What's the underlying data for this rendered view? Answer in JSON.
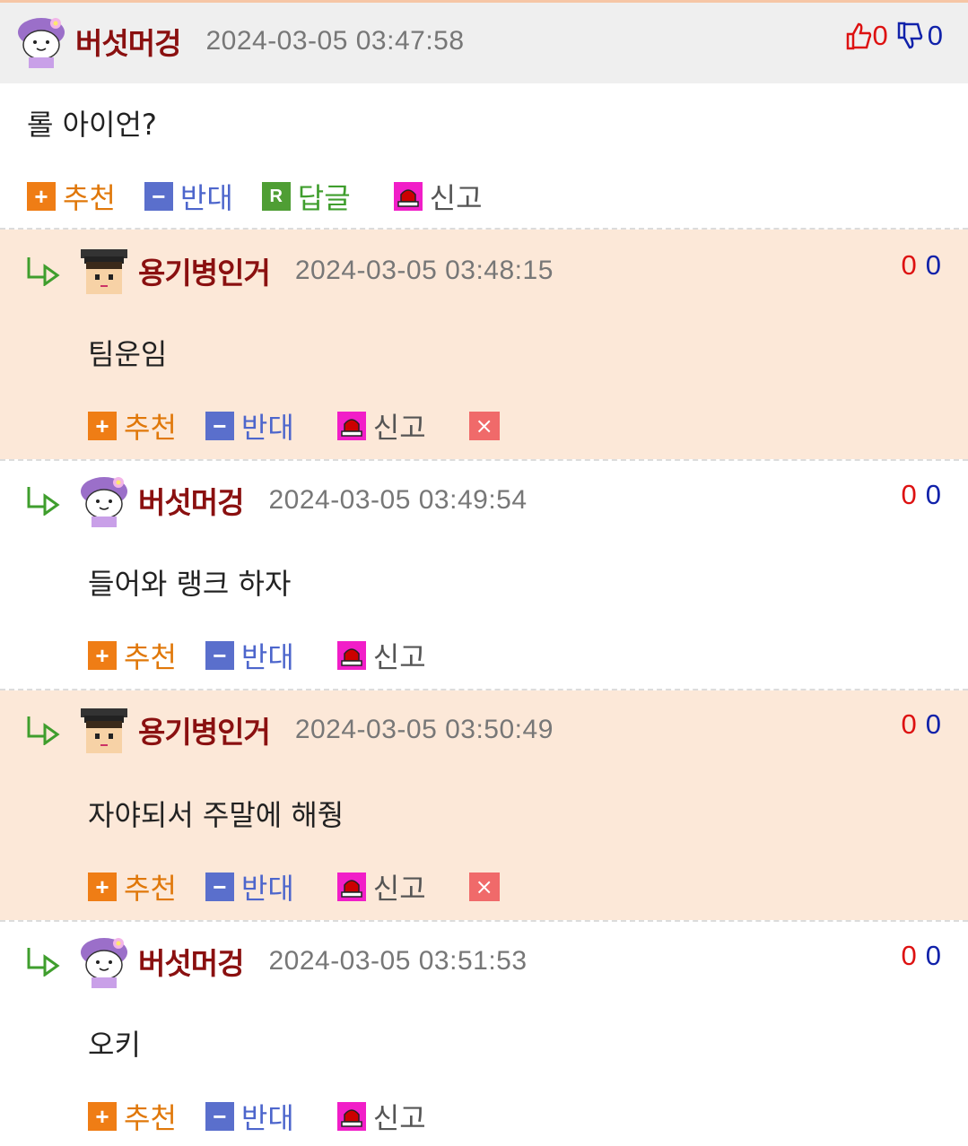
{
  "comments": [
    {
      "name": "버섯머겅",
      "date": "2024-03-05 03:47:58",
      "text": "롤 아이언?",
      "up": "0",
      "down": "0",
      "reply": "답글"
    },
    {
      "name": "용기병인거",
      "date": "2024-03-05 03:48:15",
      "text": "팀운임",
      "up": "0",
      "down": "0"
    },
    {
      "name": "버섯머겅",
      "date": "2024-03-05 03:49:54",
      "text": "들어와 랭크 하자",
      "up": "0",
      "down": "0"
    },
    {
      "name": "용기병인거",
      "date": "2024-03-05 03:50:49",
      "text": "자야되서 주말에 해줭",
      "up": "0",
      "down": "0"
    },
    {
      "name": "버섯머겅",
      "date": "2024-03-05 03:51:53",
      "text": "오키",
      "up": "0",
      "down": "0"
    }
  ],
  "actions": {
    "recommend": "추천",
    "oppose": "반대",
    "report": "신고",
    "plus": "+",
    "minus": "−",
    "reply_icon": "R",
    "delete_icon": "×"
  },
  "icons": {
    "thumbs_up": "thumbs-up-icon",
    "thumbs_down": "thumbs-down-icon",
    "reply_arrow": "reply-arrow-icon",
    "avatar_mushroom": "mushroom-avatar",
    "avatar_student": "graduate-avatar",
    "siren": "siren-icon"
  },
  "colors": {
    "header_bg": "#efefef",
    "reply_bg": "#fce8d8",
    "name": "#8a1010",
    "up": "#dd1111",
    "down": "#1122aa",
    "recommend": "#ef7d15",
    "oppose": "#5a6fcc",
    "reply": "#4f9e34",
    "report": "#f11ec8"
  }
}
